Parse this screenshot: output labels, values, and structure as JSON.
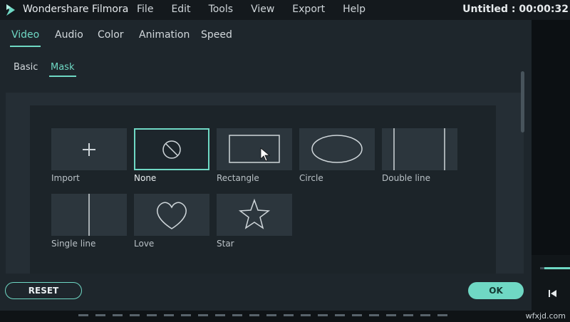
{
  "app": {
    "name": "Wondershare Filmora",
    "doc_title": "Untitled : 00:00:32"
  },
  "menu": [
    "File",
    "Edit",
    "Tools",
    "View",
    "Export",
    "Help"
  ],
  "tabs": [
    "Video",
    "Audio",
    "Color",
    "Animation",
    "Speed"
  ],
  "active_tab": "Video",
  "subtabs": [
    "Basic",
    "Mask"
  ],
  "active_subtab": "Mask",
  "masks": [
    {
      "label": "Import",
      "icon": "plus-icon",
      "selected": false
    },
    {
      "label": "None",
      "icon": "no-mask-icon",
      "selected": true
    },
    {
      "label": "Rectangle",
      "icon": "rectangle-icon",
      "selected": false
    },
    {
      "label": "Circle",
      "icon": "ellipse-icon",
      "selected": false
    },
    {
      "label": "Double line",
      "icon": "double-line-icon",
      "selected": false
    },
    {
      "label": "Single line",
      "icon": "single-line-icon",
      "selected": false
    },
    {
      "label": "Love",
      "icon": "heart-icon",
      "selected": false
    },
    {
      "label": "Star",
      "icon": "star-icon",
      "selected": false
    }
  ],
  "buttons": {
    "reset": "RESET",
    "ok": "OK"
  },
  "watermark": "wfxjd.com",
  "colors": {
    "accent": "#6fd8c4",
    "background": "#1e262c",
    "titlebar": "#14191d"
  }
}
